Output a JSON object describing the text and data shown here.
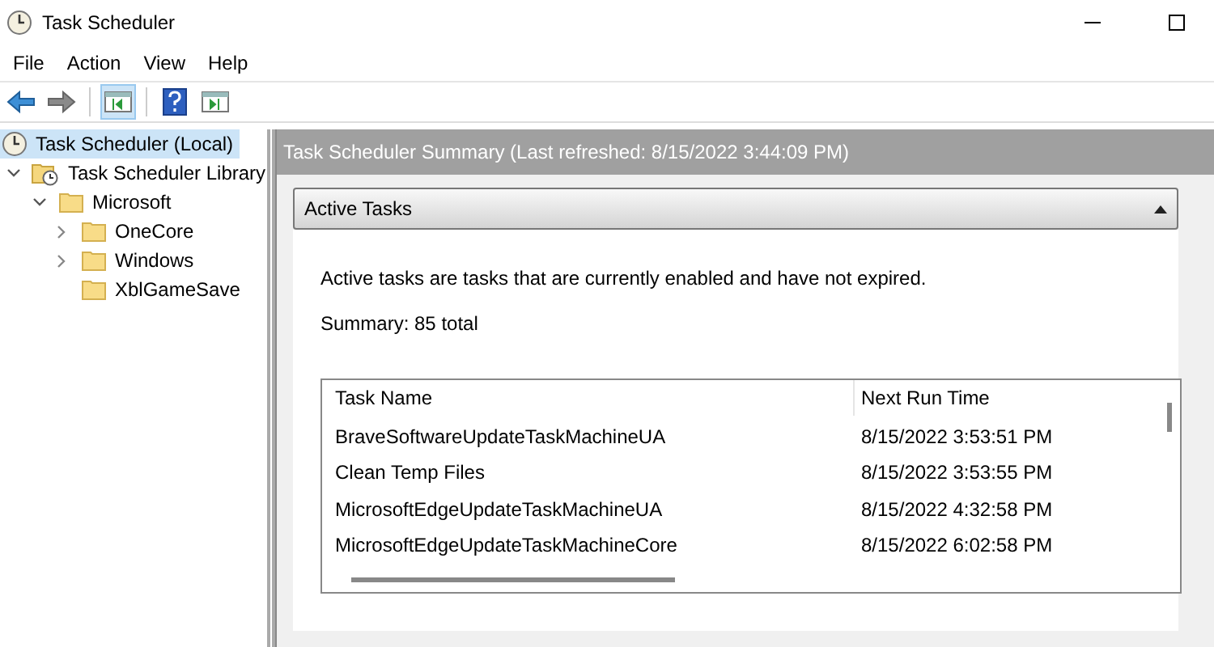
{
  "window": {
    "title": "Task Scheduler"
  },
  "menu": [
    "File",
    "Action",
    "View",
    "Help"
  ],
  "toolbar": [
    {
      "kind": "back",
      "pressed": false
    },
    {
      "kind": "forward",
      "pressed": false
    },
    {
      "kind": "pane",
      "pressed": true
    },
    {
      "kind": "help",
      "pressed": false
    },
    {
      "kind": "pane2",
      "pressed": false
    }
  ],
  "tree": [
    {
      "label": "Task Scheduler (Local)",
      "kind": "clock",
      "selected": true
    },
    {
      "label": "Task Scheduler Library",
      "kind": "library",
      "expanded": true,
      "selected": false,
      "children": [
        {
          "label": "Microsoft",
          "kind": "folder",
          "expanded": true,
          "selected": false,
          "children": [
            {
              "label": "OneCore",
              "kind": "folder",
              "expanded": false,
              "selected": false
            },
            {
              "label": "Windows",
              "kind": "folder",
              "expanded": false,
              "selected": false
            },
            {
              "label": "XblGameSave",
              "kind": "folder",
              "selected": false
            }
          ]
        }
      ]
    }
  ],
  "summary": {
    "title": "Task Scheduler Summary (Last refreshed: 8/15/2022 3:44:09 PM)",
    "section": {
      "title": "Active Tasks",
      "expanded": true,
      "description": "Active tasks are tasks that are currently enabled and have not expired.",
      "total": "Summary: 85 total",
      "table": {
        "columns": [
          "Task Name",
          "Next Run Time"
        ],
        "rows": [
          [
            "BraveSoftwareUpdateTaskMachineUA",
            "8/15/2022 3:53:51 PM"
          ],
          [
            "Clean Temp Files",
            "8/15/2022 3:53:55 PM"
          ],
          [
            "MicrosoftEdgeUpdateTaskMachineUA",
            "8/15/2022 4:32:58 PM"
          ],
          [
            "MicrosoftEdgeUpdateTaskMachineCore",
            "8/15/2022 6:02:58 PM"
          ]
        ]
      }
    }
  }
}
